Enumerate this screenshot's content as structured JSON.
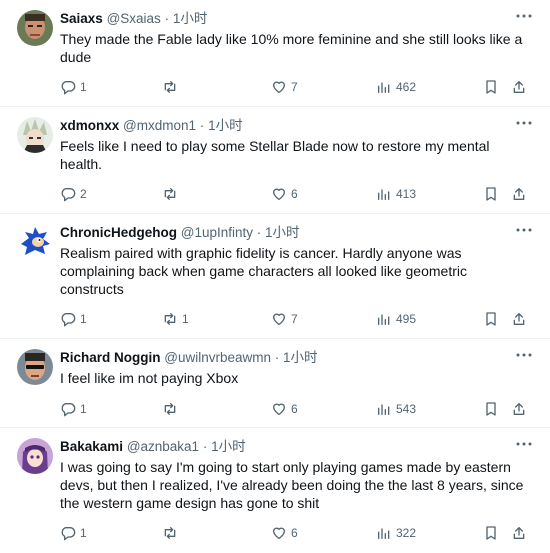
{
  "colors": {
    "text": "#0f1419",
    "secondary": "#536471",
    "divider": "#eff3f4"
  },
  "tweets": [
    {
      "name": "Saiaxs",
      "handle": "@Sxaias",
      "sep": "·",
      "time": "1小时",
      "text": "They made the Fable lady like 10% more feminine and she still looks like a dude",
      "replies": "1",
      "retweets": "",
      "likes": "7",
      "views": "462"
    },
    {
      "name": "xdmonxx",
      "handle": "@mxdmon1",
      "sep": "·",
      "time": "1小时",
      "text": "Feels like I need to play some Stellar Blade now to restore my mental health.",
      "replies": "2",
      "retweets": "",
      "likes": "6",
      "views": "413"
    },
    {
      "name": "ChronicHedgehog",
      "handle": "@1upInfinty",
      "sep": "·",
      "time": "1小时",
      "text": "Realism paired with graphic fidelity is cancer. Hardly anyone was complaining back when game characters all looked like geometric constructs",
      "replies": "1",
      "retweets": "1",
      "likes": "7",
      "views": "495"
    },
    {
      "name": "Richard Noggin",
      "handle": "@uwilnvrbeawmn",
      "sep": "·",
      "time": "1小时",
      "text": "I feel like im not paying Xbox",
      "replies": "1",
      "retweets": "",
      "likes": "6",
      "views": "543"
    },
    {
      "name": "Bakakami",
      "handle": "@aznbaka1",
      "sep": "·",
      "time": "1小时",
      "text": "I was going to say I'm going to start only playing games made by eastern devs, but then I realized, I've already been doing the the last 8 years, since the western game design has gone to shit",
      "replies": "1",
      "retweets": "",
      "likes": "6",
      "views": "322"
    }
  ]
}
